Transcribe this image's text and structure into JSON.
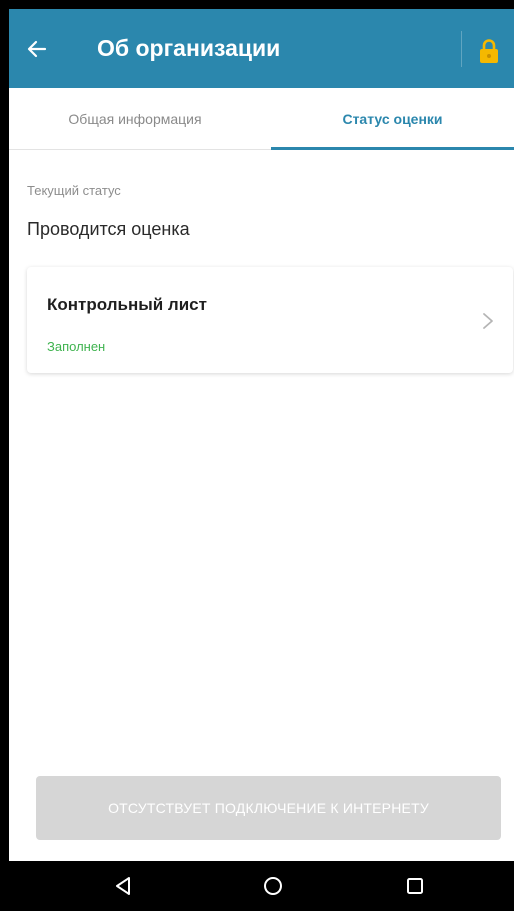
{
  "app_bar": {
    "title": "Об организации",
    "back_icon": "arrow-left-icon",
    "lock_icon": "lock-icon",
    "lock_color": "#f5b800",
    "background": "#2b87ad"
  },
  "tabs": [
    {
      "label": "Общая информация",
      "active": false
    },
    {
      "label": "Статус оценки",
      "active": true
    }
  ],
  "status": {
    "label": "Текущий статус",
    "value": "Проводится оценка"
  },
  "checklist_card": {
    "title": "Контрольный лист",
    "status": "Заполнен",
    "status_color": "#3fb34f",
    "chevron_icon": "chevron-right-icon"
  },
  "footer_button": {
    "label": "ОТСУТСТВУЕТ ПОДКЛЮЧЕНИЕ К ИНТЕРНЕТУ",
    "enabled": false
  },
  "system_nav": {
    "back_icon": "nav-back-icon",
    "home_icon": "nav-home-icon",
    "recent_icon": "nav-recent-icon"
  }
}
